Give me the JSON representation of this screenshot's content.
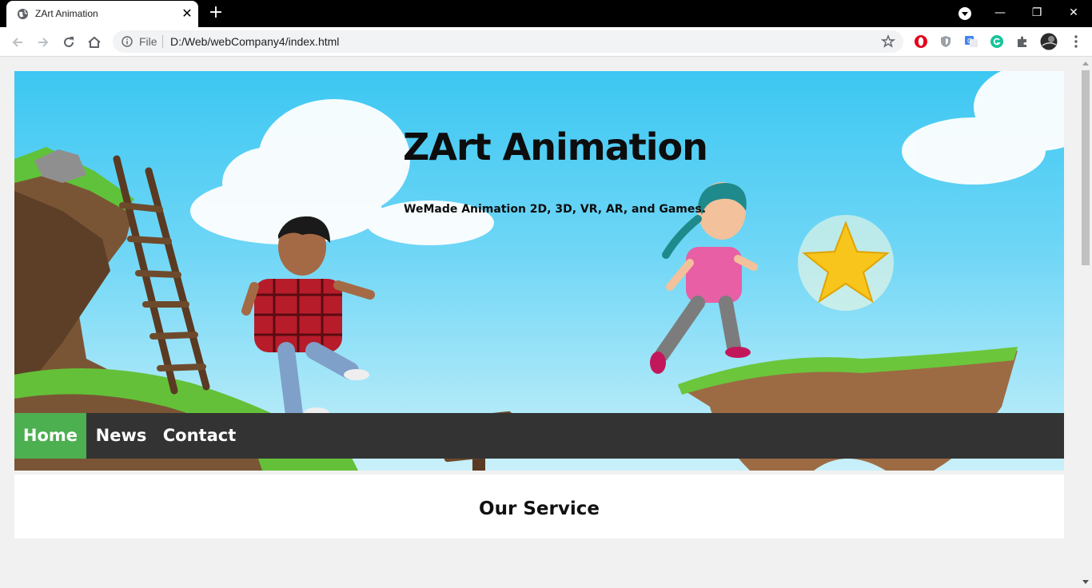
{
  "browser": {
    "tab": {
      "title": "ZArt Animation",
      "favicon": "globe-icon",
      "close": "✕"
    },
    "new_tab": "+",
    "window_controls": {
      "minimize": "—",
      "restore": "❐",
      "close": "✕"
    },
    "address": {
      "scheme_label": "File",
      "url": "D:/Web/webCompany4/index.html"
    }
  },
  "hero": {
    "title": "ZArt Animation",
    "subtitle": "WeMade Animation 2D, 3D, VR, AR, and Games."
  },
  "nav": {
    "items": [
      {
        "label": "Home",
        "active": true
      },
      {
        "label": "News",
        "active": false
      },
      {
        "label": "Contact",
        "active": false
      }
    ]
  },
  "content": {
    "section_title": "Our Service"
  },
  "colors": {
    "nav_bg": "#333333",
    "nav_active": "#4caf50",
    "sky": "#3cc7f2"
  }
}
